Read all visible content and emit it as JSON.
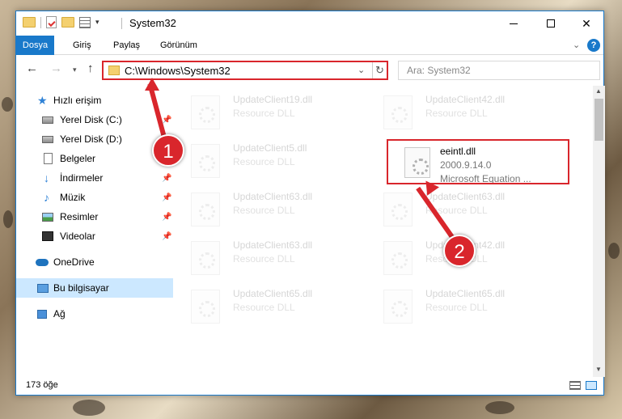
{
  "titlebar": {
    "title": "System32"
  },
  "ribbon": {
    "tabs": [
      "Dosya",
      "Giriş",
      "Paylaş",
      "Görünüm"
    ]
  },
  "navigation": {
    "address": "C:\\Windows\\System32",
    "search_placeholder": "Ara: System32"
  },
  "sidebar": {
    "items": [
      {
        "label": "Hızlı erişim",
        "icon": "star-icon"
      },
      {
        "label": "Yerel Disk (C:)",
        "icon": "disk-icon"
      },
      {
        "label": "Yerel Disk (D:)",
        "icon": "disk-icon"
      },
      {
        "label": "Belgeler",
        "icon": "documents-icon"
      },
      {
        "label": "İndirmeler",
        "icon": "download-icon"
      },
      {
        "label": "Müzik",
        "icon": "music-icon"
      },
      {
        "label": "Resimler",
        "icon": "pictures-icon"
      },
      {
        "label": "Videolar",
        "icon": "videos-icon"
      },
      {
        "label": "OneDrive",
        "icon": "cloud-icon"
      },
      {
        "label": "Bu bilgisayar",
        "icon": "computer-icon"
      },
      {
        "label": "Ağ",
        "icon": "network-icon"
      }
    ]
  },
  "files": {
    "left_column": [
      {
        "name": "UpdateClient19.dll",
        "type": "Resource DLL"
      },
      {
        "name": "UpdateClient5.dll",
        "type": "Resource DLL"
      },
      {
        "name": "UpdateClient63.dll",
        "type": "Resource DLL"
      },
      {
        "name": "UpdateClient63.dll",
        "type": "Resource DLL"
      },
      {
        "name": "UpdateClient65.dll",
        "type": "Resource DLL"
      }
    ],
    "right_column": [
      {
        "name": "UpdateClient42.dll",
        "type": "Resource DLL"
      },
      {
        "name": "UpdateClient63.dll",
        "type": "Resource DLL"
      },
      {
        "name": "UpdateClient42.dll",
        "type": "Resource DLL"
      },
      {
        "name": "UpdateClient65.dll",
        "type": "Resource DLL"
      }
    ],
    "highlighted": {
      "name": "eeintl.dll",
      "version": "2000.9.14.0",
      "description": "Microsoft Equation ..."
    }
  },
  "status": {
    "item_count": "173 öğe"
  },
  "annotations": {
    "step1": "1",
    "step2": "2",
    "color": "#d9262c"
  }
}
